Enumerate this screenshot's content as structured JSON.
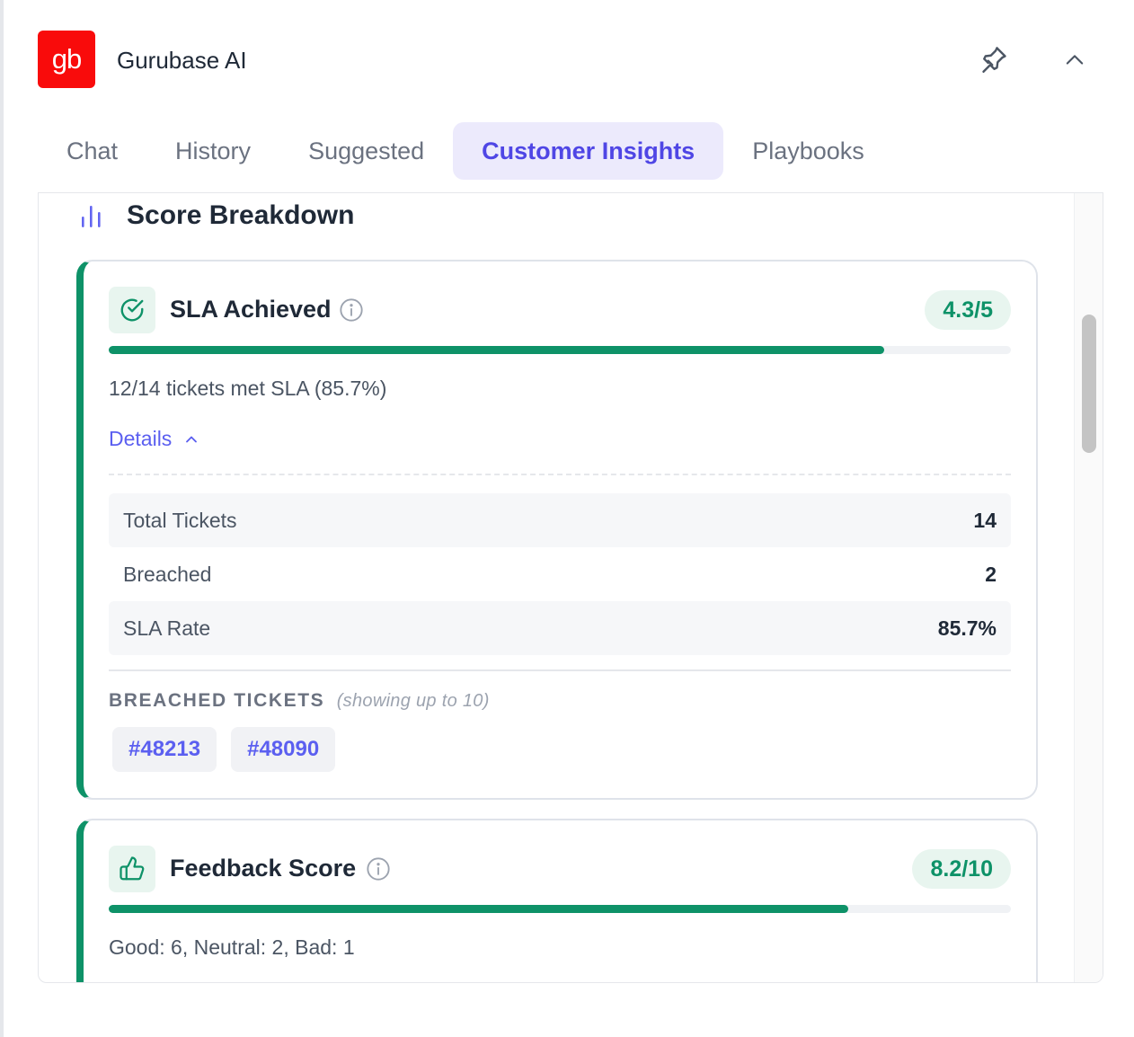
{
  "header": {
    "logo_text": "gb",
    "app_title": "Gurubase AI",
    "pin_icon": "pin-icon",
    "collapse_icon": "chevron-up-icon"
  },
  "tabs": [
    {
      "label": "Chat",
      "active": false
    },
    {
      "label": "History",
      "active": false
    },
    {
      "label": "Suggested",
      "active": false
    },
    {
      "label": "Customer Insights",
      "active": true
    },
    {
      "label": "Playbooks",
      "active": false
    }
  ],
  "section": {
    "title": "Score Breakdown",
    "icon": "bar-chart-icon"
  },
  "cards": [
    {
      "title": "SLA Achieved",
      "icon": "check-circle-icon",
      "score": "4.3/5",
      "progress_fraction": 0.86,
      "summary": "12/14 tickets met SLA (85.7%)",
      "details_label": "Details",
      "stats": [
        {
          "label": "Total Tickets",
          "value": "14"
        },
        {
          "label": "Breached",
          "value": "2"
        },
        {
          "label": "SLA Rate",
          "value": "85.7%"
        }
      ],
      "breached_heading": "BREACHED TICKETS",
      "breached_note": "(showing up to 10)",
      "breached_tickets": [
        "#48213",
        "#48090"
      ]
    },
    {
      "title": "Feedback Score",
      "icon": "thumbs-up-icon",
      "score": "8.2/10",
      "progress_fraction": 0.82,
      "summary": "Good: 6, Neutral: 2, Bad: 1"
    }
  ],
  "colors": {
    "brand_red": "#f90b0b",
    "accent_indigo": "#4f46e5",
    "success_green": "#0e9268"
  }
}
